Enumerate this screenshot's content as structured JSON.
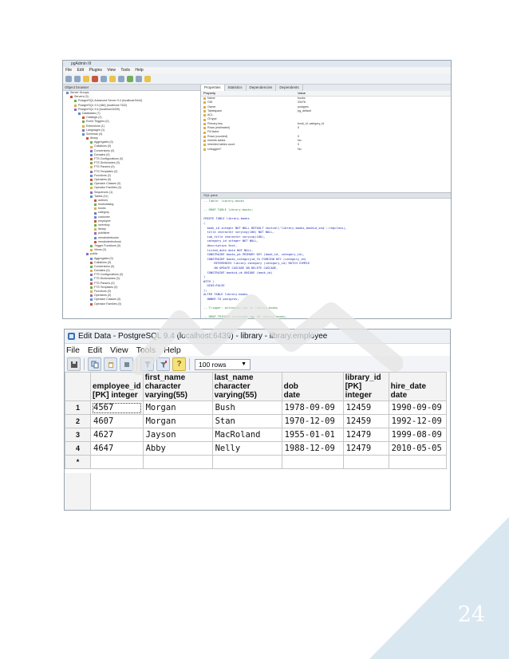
{
  "pgadmin": {
    "title": "pgAdmin III",
    "menu": [
      "File",
      "Edit",
      "Plugins",
      "View",
      "Tools",
      "Help"
    ],
    "tree_header": "Object browser",
    "tree": [
      "Server Groups",
      "Servers (3)",
      "PostgreSQL Advanced Server 9.4 (localhost:5444)",
      "PostgreSQL 9.3 (x86) (localhost:7432)",
      "PostgreSQL 9.4 (localhost:6439)",
      "Databases (7)",
      "Catalogs (2)",
      "Event Triggers (0)",
      "Extensions (1)",
      "Languages (1)",
      "Schemas (4)",
      "library",
      "Aggregates (0)",
      "Collations (0)",
      "Conversions (0)",
      "Domains (0)",
      "FTS Configurations (0)",
      "FTS Dictionaries (0)",
      "FTS Parsers (0)",
      "FTS Templates (0)",
      "Functions (2)",
      "Operators (0)",
      "Operator Classes (0)",
      "Operator Families (0)",
      "Sequences (1)",
      "Tables (11)",
      "authors",
      "bookcatalog",
      "books",
      "category",
      "customer",
      "employee",
      "inventory",
      "library",
      "publisher",
      "remainderbooks",
      "remaindertexbook",
      "Trigger Functions (0)",
      "Views (0)",
      "public",
      "Aggregates (0)",
      "Collations (0)",
      "Conversions (0)",
      "Domains (0)",
      "FTS Configurations (0)",
      "FTS Dictionaries (0)",
      "FTS Parsers (0)",
      "FTS Templates (0)",
      "Functions (0)",
      "Operators (0)",
      "Operator Classes (0)",
      "Operator Families (0)"
    ],
    "prop_tabs": [
      "Properties",
      "Statistics",
      "Dependencies",
      "Dependents"
    ],
    "prop_header": {
      "key": "Property",
      "value": "Value"
    },
    "properties": [
      {
        "key": "Name",
        "value": "books"
      },
      {
        "key": "OID",
        "value": "33478"
      },
      {
        "key": "Owner",
        "value": "postgres"
      },
      {
        "key": "Tablespace",
        "value": "pg_default"
      },
      {
        "key": "ACL",
        "value": ""
      },
      {
        "key": "Of type",
        "value": ""
      },
      {
        "key": "Primary key",
        "value": "book_id, category_id"
      },
      {
        "key": "Rows (estimated)",
        "value": "0"
      },
      {
        "key": "Fill factor",
        "value": ""
      },
      {
        "key": "Rows (counted)",
        "value": "0"
      },
      {
        "key": "Inherits tables",
        "value": "No"
      },
      {
        "key": "Inherited tables count",
        "value": "0"
      },
      {
        "key": "Unlogged?",
        "value": "No"
      }
    ],
    "sql_header": "SQL pane",
    "sql": [
      {
        "t": "-- Table: library.books",
        "c": true
      },
      {
        "t": "",
        "c": false
      },
      {
        "t": "-- DROP TABLE library.books;",
        "c": true
      },
      {
        "t": "",
        "c": false
      },
      {
        "t": "CREATE TABLE library.books",
        "c": false
      },
      {
        "t": "(",
        "c": false
      },
      {
        "t": "  book_id integer NOT NULL DEFAULT nextval('library.books_bookid_seq'::regclass),",
        "c": false
      },
      {
        "t": "  title character varying(100) NOT NULL,",
        "c": false
      },
      {
        "t": "  sub_title character varying(100),",
        "c": false
      },
      {
        "t": "  category_id integer NOT NULL,",
        "c": false
      },
      {
        "t": "  description text,",
        "c": false
      },
      {
        "t": "  listed_date date NOT NULL,",
        "c": false
      },
      {
        "t": "  CONSTRAINT books_pk PRIMARY KEY (book_id, category_id),",
        "c": false
      },
      {
        "t": "  CONSTRAINT books_categoryid_fk FOREIGN KEY (category_id)",
        "c": false
      },
      {
        "t": "      REFERENCES library.category (category_id) MATCH SIMPLE",
        "c": false
      },
      {
        "t": "      ON UPDATE CASCADE ON DELETE CASCADE,",
        "c": false
      },
      {
        "t": "  CONSTRAINT bookid_uk UNIQUE (book_id)",
        "c": false
      },
      {
        "t": ")",
        "c": false
      },
      {
        "t": "WITH (",
        "c": false
      },
      {
        "t": "  OIDS=FALSE",
        "c": false
      },
      {
        "t": ");",
        "c": false
      },
      {
        "t": "ALTER TABLE library.books",
        "c": false
      },
      {
        "t": "  OWNER TO postgres;",
        "c": false
      },
      {
        "t": "",
        "c": false
      },
      {
        "t": "-- Trigger: actionadd_tgg on library.books",
        "c": true
      },
      {
        "t": "",
        "c": false
      },
      {
        "t": "-- DROP TRIGGER actionadd_tgg ON library.books;",
        "c": true
      },
      {
        "t": "",
        "c": false
      },
      {
        "t": "CREATE TRIGGER actionadd_tgg",
        "c": false
      },
      {
        "t": "  AFTER INSERT OR UPDATE OR DELETE",
        "c": false
      },
      {
        "t": "  ON library.books",
        "c": false
      },
      {
        "t": "  FOR EACH ROW",
        "c": false
      },
      {
        "t": "  EXECUTE PROCEDURE actionadd();",
        "c": false
      }
    ]
  },
  "edit_window": {
    "title": "Edit Data - PostgreSQL 9.4 (localhost:6439) - library - library.employee",
    "menu": [
      "File",
      "Edit",
      "View",
      "Tools",
      "Help"
    ],
    "rows_select": "100 rows",
    "columns": [
      {
        "name": "employee_id",
        "type": "[PK] integer"
      },
      {
        "name": "first_name",
        "type": "character varying(55)"
      },
      {
        "name": "last_name",
        "type": "character varying(55)"
      },
      {
        "name": "dob",
        "type": "date"
      },
      {
        "name": "library_id",
        "type": "[PK] integer"
      },
      {
        "name": "hire_date",
        "type": "date"
      }
    ],
    "rows": [
      {
        "n": "1",
        "cells": [
          "4567",
          "Morgan",
          "Bush",
          "1978-09-09",
          "12459",
          "1990-09-09"
        ]
      },
      {
        "n": "2",
        "cells": [
          "4607",
          "Morgan",
          "Stan",
          "1970-12-09",
          "12459",
          "1992-12-09"
        ]
      },
      {
        "n": "3",
        "cells": [
          "4627",
          "Jayson",
          "MacRoland",
          "1955-01-01",
          "12479",
          "1999-08-09"
        ]
      },
      {
        "n": "4",
        "cells": [
          "4647",
          "Abby",
          "Nelly",
          "1988-12-09",
          "12479",
          "2010-05-05"
        ]
      }
    ],
    "new_row_marker": "*"
  },
  "page_number": "24",
  "colors": {
    "corner_triangle": "#d9e7f1",
    "watermark": "#e4e4e4",
    "page_number": "#ffffff"
  }
}
